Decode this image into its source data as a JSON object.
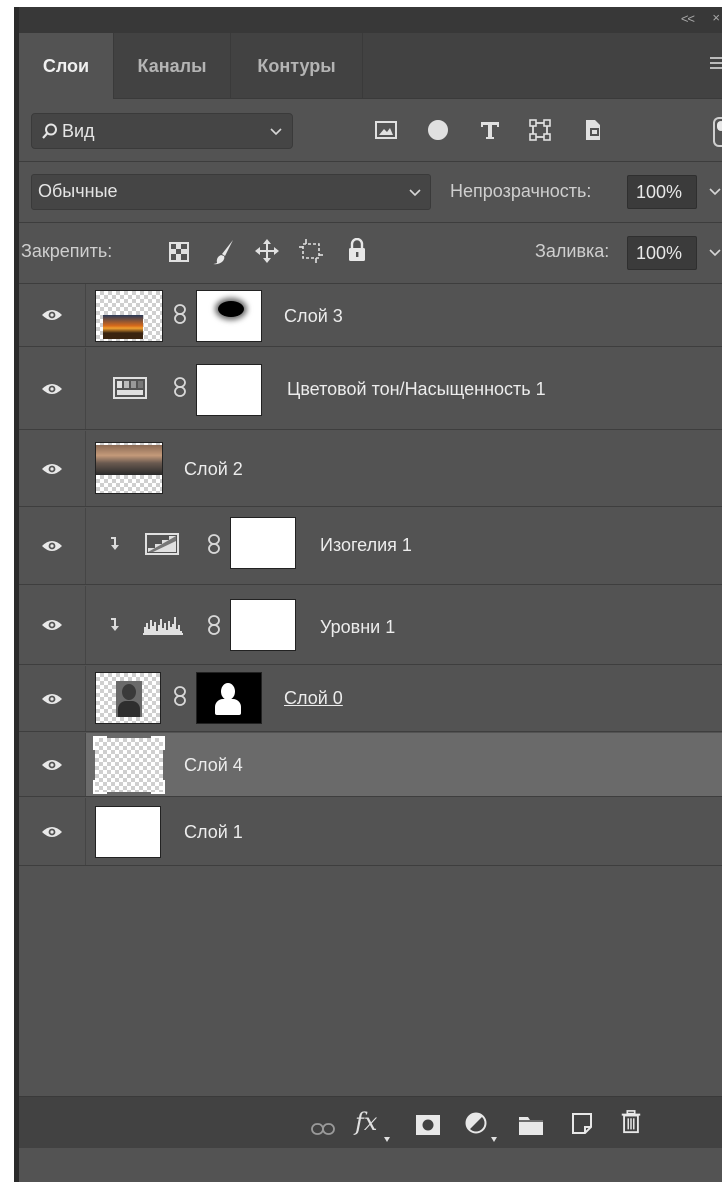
{
  "header": {
    "collapse_label": "<<",
    "close_label": "×"
  },
  "tabs": [
    {
      "label": "Слои",
      "active": true
    },
    {
      "label": "Каналы",
      "active": false
    },
    {
      "label": "Контуры",
      "active": false
    }
  ],
  "filter": {
    "kind_label": "Вид",
    "icons": [
      "image-filter-icon",
      "adjustment-filter-icon",
      "type-filter-icon",
      "shape-filter-icon",
      "smart-object-filter-icon"
    ]
  },
  "blend": {
    "mode": "Обычные",
    "opacity_label": "Непрозрачность:",
    "opacity_value": "100%"
  },
  "lock": {
    "label": "Закрепить:",
    "fill_label": "Заливка:",
    "fill_value": "100%"
  },
  "layers": [
    {
      "name": "Слой 3",
      "type": "pixel-with-mask"
    },
    {
      "name": "Цветовой тон/Насыщенность 1",
      "type": "hue-saturation"
    },
    {
      "name": "Слой 2",
      "type": "pixel"
    },
    {
      "name": "Изогелия 1",
      "type": "posterize-clipped"
    },
    {
      "name": "Уровни 1",
      "type": "levels-clipped"
    },
    {
      "name": "Слой 0",
      "type": "pixel-with-mask"
    },
    {
      "name": "Слой 4",
      "type": "empty",
      "selected": true
    },
    {
      "name": "Слой 1",
      "type": "white"
    }
  ],
  "bottom_bar": {
    "fx_label": "fx",
    "icons": [
      "link-layers-icon",
      "fx-icon",
      "add-mask-icon",
      "new-adjustment-icon",
      "new-group-icon",
      "new-layer-icon",
      "delete-icon"
    ]
  }
}
